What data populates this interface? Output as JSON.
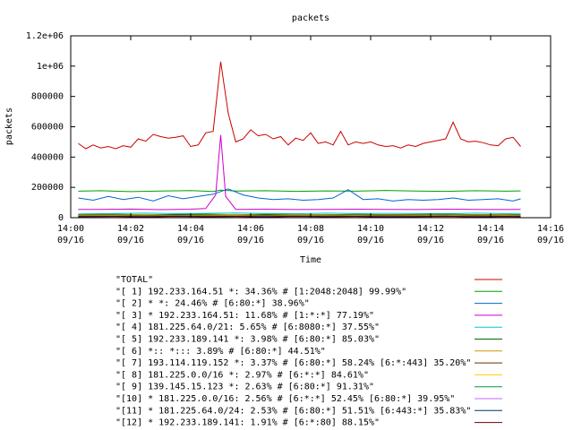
{
  "chart_data": {
    "type": "line",
    "title": "packets",
    "xlabel": "Time",
    "ylabel": "packets",
    "x_ticks": [
      {
        "time": "14:00",
        "date": "09/16"
      },
      {
        "time": "14:02",
        "date": "09/16"
      },
      {
        "time": "14:04",
        "date": "09/16"
      },
      {
        "time": "14:06",
        "date": "09/16"
      },
      {
        "time": "14:08",
        "date": "09/16"
      },
      {
        "time": "14:10",
        "date": "09/16"
      },
      {
        "time": "14:12",
        "date": "09/16"
      },
      {
        "time": "14:14",
        "date": "09/16"
      },
      {
        "time": "14:16",
        "date": "09/16"
      }
    ],
    "y_ticks": [
      "0",
      "200000",
      "400000",
      "600000",
      "800000",
      "1e+06",
      "1.2e+06"
    ],
    "xlim": [
      "14:00",
      "14:16"
    ],
    "ylim": [
      0,
      1200000
    ],
    "grid": false,
    "legend_placement": "below",
    "series": [
      {
        "name": "\"TOTAL\"",
        "color": "#cc0000",
        "x": [
          "14:00:15",
          "14:00:30",
          "14:00:45",
          "14:01:00",
          "14:01:15",
          "14:01:30",
          "14:01:45",
          "14:02:00",
          "14:02:15",
          "14:02:30",
          "14:02:45",
          "14:03:00",
          "14:03:15",
          "14:03:30",
          "14:03:45",
          "14:04:00",
          "14:04:15",
          "14:04:30",
          "14:04:45",
          "14:05:00",
          "14:05:15",
          "14:05:30",
          "14:05:45",
          "14:06:00",
          "14:06:15",
          "14:06:30",
          "14:06:45",
          "14:07:00",
          "14:07:15",
          "14:07:30",
          "14:07:45",
          "14:08:00",
          "14:08:15",
          "14:08:30",
          "14:08:45",
          "14:09:00",
          "14:09:15",
          "14:09:30",
          "14:09:45",
          "14:10:00",
          "14:10:15",
          "14:10:30",
          "14:10:45",
          "14:11:00",
          "14:11:15",
          "14:11:30",
          "14:11:45",
          "14:12:00",
          "14:12:15",
          "14:12:30",
          "14:12:45",
          "14:13:00",
          "14:13:15",
          "14:13:30",
          "14:13:45",
          "14:14:00",
          "14:14:15",
          "14:14:30",
          "14:14:45",
          "14:15:00"
        ],
        "values": [
          490000,
          455000,
          480000,
          460000,
          470000,
          455000,
          475000,
          465000,
          520000,
          505000,
          550000,
          535000,
          525000,
          530000,
          540000,
          470000,
          480000,
          560000,
          570000,
          1030000,
          690000,
          500000,
          520000,
          580000,
          540000,
          550000,
          520000,
          535000,
          480000,
          525000,
          510000,
          560000,
          490000,
          500000,
          480000,
          570000,
          480000,
          500000,
          490000,
          500000,
          480000,
          470000,
          475000,
          460000,
          480000,
          470000,
          490000,
          500000,
          510000,
          520000,
          630000,
          520000,
          500000,
          505000,
          495000,
          480000,
          475000,
          520000,
          530000,
          470000
        ]
      },
      {
        "name": "\"[ 1] 192.233.164.51 *: 34.36% # [1:2048:2048] 99.99%\"",
        "color": "#00a000",
        "x": [
          "14:00:15",
          "14:01:00",
          "14:02:00",
          "14:03:00",
          "14:04:00",
          "14:04:45",
          "14:05:00",
          "14:05:30",
          "14:06:30",
          "14:07:30",
          "14:08:30",
          "14:09:30",
          "14:10:30",
          "14:11:30",
          "14:12:30",
          "14:13:30",
          "14:14:30",
          "14:15:00"
        ],
        "values": [
          175000,
          178000,
          172000,
          176000,
          179000,
          173000,
          182000,
          176000,
          178000,
          174000,
          177000,
          175000,
          180000,
          176000,
          174000,
          178000,
          175000,
          177000
        ]
      },
      {
        "name": "\"[ 2] * *: 24.46% # [6:80:*] 38.96%\"",
        "color": "#0066cc",
        "x": [
          "14:00:15",
          "14:00:45",
          "14:01:15",
          "14:01:45",
          "14:02:15",
          "14:02:45",
          "14:03:15",
          "14:03:45",
          "14:04:15",
          "14:04:45",
          "14:05:15",
          "14:05:45",
          "14:06:15",
          "14:06:45",
          "14:07:15",
          "14:07:45",
          "14:08:15",
          "14:08:45",
          "14:09:15",
          "14:09:45",
          "14:10:15",
          "14:10:45",
          "14:11:15",
          "14:11:45",
          "14:12:15",
          "14:12:45",
          "14:13:15",
          "14:13:45",
          "14:14:15",
          "14:14:45",
          "14:15:00"
        ],
        "values": [
          130000,
          115000,
          140000,
          120000,
          135000,
          110000,
          145000,
          125000,
          140000,
          155000,
          190000,
          150000,
          130000,
          120000,
          125000,
          115000,
          120000,
          130000,
          185000,
          120000,
          125000,
          110000,
          120000,
          115000,
          120000,
          130000,
          115000,
          120000,
          125000,
          110000,
          125000
        ]
      },
      {
        "name": "\"[ 3] * 192.233.164.51: 11.68% # [1:*:*] 77.19%\"",
        "color": "#cc00cc",
        "x": [
          "14:00:15",
          "14:01:00",
          "14:02:00",
          "14:03:00",
          "14:04:00",
          "14:04:30",
          "14:04:50",
          "14:05:00",
          "14:05:10",
          "14:05:30",
          "14:06:30",
          "14:07:30",
          "14:08:30",
          "14:09:30",
          "14:10:30",
          "14:11:30",
          "14:12:30",
          "14:13:30",
          "14:14:30",
          "14:15:00"
        ],
        "values": [
          55000,
          55000,
          57000,
          53000,
          56000,
          60000,
          150000,
          545000,
          140000,
          55000,
          56000,
          54000,
          55000,
          56000,
          55000,
          54000,
          56000,
          55000,
          54000,
          55000
        ]
      },
      {
        "name": "\"[ 4] 181.225.64.0/21: 5.65% # [6:8080:*] 37.55%\"",
        "color": "#00cccc",
        "x": [
          "14:00:15",
          "14:01:30",
          "14:02:30",
          "14:03:30",
          "14:04:30",
          "14:05:30",
          "14:06:30",
          "14:07:30",
          "14:08:30",
          "14:09:30",
          "14:10:30",
          "14:11:30",
          "14:12:30",
          "14:13:30",
          "14:14:30",
          "14:15:00"
        ],
        "values": [
          25000,
          28000,
          30000,
          27000,
          29000,
          31000,
          28000,
          26000,
          30000,
          27000,
          29000,
          28000,
          26000,
          30000,
          27000,
          28000
        ]
      },
      {
        "name": "\"[ 5] 192.233.189.141 *: 3.98% # [6:80:*] 85.03%\"",
        "color": "#006600",
        "x": [
          "14:00:15",
          "14:01:30",
          "14:02:30",
          "14:03:30",
          "14:04:30",
          "14:05:30",
          "14:06:30",
          "14:07:30",
          "14:08:30",
          "14:09:30",
          "14:10:30",
          "14:11:30",
          "14:12:30",
          "14:13:30",
          "14:14:30",
          "14:15:00"
        ],
        "values": [
          20000,
          22000,
          19000,
          21000,
          23000,
          20000,
          22000,
          21000,
          19000,
          22000,
          20000,
          21000,
          23000,
          20000,
          21000,
          20000
        ]
      },
      {
        "name": "\"[ 6] *:: *::: 3.89% # [6:80:*] 44.51%\"",
        "color": "#cc9900",
        "x": [
          "14:00:15",
          "14:01:30",
          "14:02:30",
          "14:03:30",
          "14:04:30",
          "14:05:30",
          "14:06:30",
          "14:07:30",
          "14:08:30",
          "14:09:30",
          "14:10:30",
          "14:11:30",
          "14:12:30",
          "14:13:30",
          "14:14:30",
          "14:15:00"
        ],
        "values": [
          18000,
          19000,
          20000,
          17000,
          19000,
          21000,
          18000,
          20000,
          19000,
          18000,
          20000,
          19000,
          18000,
          20000,
          19000,
          18000
        ]
      },
      {
        "name": "\"[ 7] 193.114.119.152 *: 3.37% # [6:80:*] 58.24% [6:*:443] 35.20%\"",
        "color": "#663300",
        "x": [
          "14:00:15",
          "14:01:30",
          "14:02:30",
          "14:03:30",
          "14:04:30",
          "14:05:30",
          "14:06:30",
          "14:07:30",
          "14:08:30",
          "14:09:30",
          "14:10:30",
          "14:11:30",
          "14:12:30",
          "14:13:30",
          "14:14:30",
          "14:15:00"
        ],
        "values": [
          15000,
          16000,
          14000,
          17000,
          16000,
          15000,
          17000,
          14000,
          16000,
          15000,
          17000,
          16000,
          14000,
          16000,
          15000,
          16000
        ]
      },
      {
        "name": "\"[ 8] 181.225.0.0/16 *: 2.97% # [6:*:*] 84.61%\"",
        "color": "#ffcc00",
        "x": [
          "14:00:15",
          "14:01:30",
          "14:02:30",
          "14:03:30",
          "14:04:30",
          "14:05:30",
          "14:06:30",
          "14:07:30",
          "14:08:30",
          "14:09:30",
          "14:10:30",
          "14:11:30",
          "14:12:30",
          "14:13:30",
          "14:14:30",
          "14:15:00"
        ],
        "values": [
          13000,
          14000,
          12000,
          15000,
          13000,
          14000,
          12000,
          15000,
          13000,
          14000,
          12000,
          13000,
          15000,
          12000,
          14000,
          13000
        ]
      },
      {
        "name": "\"[ 9] 139.145.15.123 *: 2.63% # [6:80:*] 91.31%\"",
        "color": "#00994c",
        "x": [
          "14:00:15",
          "14:01:30",
          "14:02:30",
          "14:03:30",
          "14:04:30",
          "14:05:30",
          "14:06:30",
          "14:07:30",
          "14:08:30",
          "14:09:30",
          "14:10:30",
          "14:11:30",
          "14:12:30",
          "14:13:30",
          "14:14:30",
          "14:15:00"
        ],
        "values": [
          11000,
          12000,
          10000,
          13000,
          11000,
          12000,
          10000,
          13000,
          11000,
          12000,
          10000,
          11000,
          13000,
          10000,
          12000,
          11000
        ]
      },
      {
        "name": "\"[10] * 181.225.0.0/16: 2.56% # [6:*:*] 52.45% [6:80:*] 39.95%\"",
        "color": "#cc66ff",
        "x": [
          "14:00:15",
          "14:01:30",
          "14:02:30",
          "14:03:30",
          "14:04:30",
          "14:05:30",
          "14:06:30",
          "14:07:30",
          "14:08:30",
          "14:09:30",
          "14:10:30",
          "14:11:30",
          "14:12:30",
          "14:13:30",
          "14:14:30",
          "14:15:00"
        ],
        "values": [
          9000,
          10000,
          8000,
          11000,
          9000,
          10000,
          8000,
          11000,
          9000,
          10000,
          8000,
          9000,
          11000,
          8000,
          10000,
          9000
        ]
      },
      {
        "name": "\"[11] * 181.225.64.0/24: 2.53% # [6:80:*] 51.51% [6:443:*] 35.83%\"",
        "color": "#003366",
        "x": [
          "14:00:15",
          "14:01:30",
          "14:02:30",
          "14:03:30",
          "14:04:30",
          "14:05:30",
          "14:06:30",
          "14:07:30",
          "14:08:30",
          "14:09:30",
          "14:10:30",
          "14:11:30",
          "14:12:30",
          "14:13:30",
          "14:14:30",
          "14:15:00"
        ],
        "values": [
          8000,
          9000,
          7000,
          10000,
          8000,
          9000,
          7000,
          10000,
          8000,
          9000,
          7000,
          8000,
          10000,
          7000,
          9000,
          8000
        ]
      },
      {
        "name": "\"[12] * 192.233.189.141: 1.91% # [6:*:80] 88.15%\"",
        "color": "#660000",
        "x": [
          "14:00:15",
          "14:01:30",
          "14:02:30",
          "14:03:30",
          "14:04:30",
          "14:05:30",
          "14:06:30",
          "14:07:30",
          "14:08:30",
          "14:09:30",
          "14:10:30",
          "14:11:30",
          "14:12:30",
          "14:13:30",
          "14:14:30",
          "14:15:00"
        ],
        "values": [
          6000,
          7000,
          5000,
          8000,
          6000,
          7000,
          5000,
          8000,
          6000,
          7000,
          5000,
          6000,
          8000,
          5000,
          7000,
          6000
        ]
      }
    ]
  }
}
